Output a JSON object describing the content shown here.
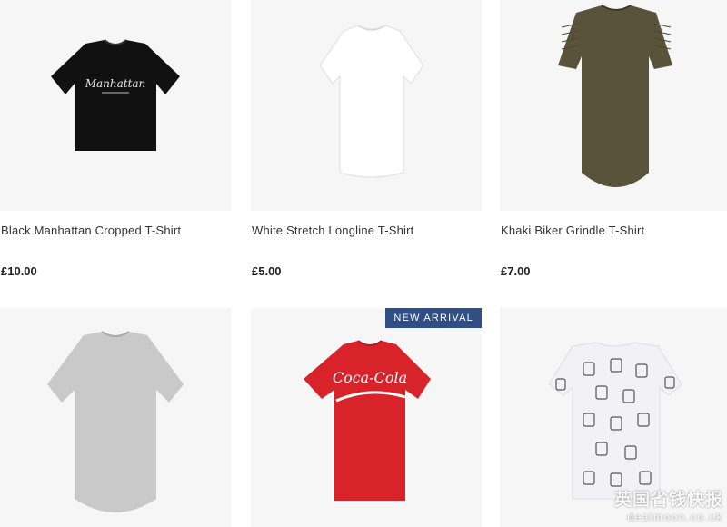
{
  "products": [
    {
      "title": "Black Manhattan Cropped T-Shirt",
      "price": "£10.00",
      "print_text": "Manhattan",
      "shirt_color": "#111111"
    },
    {
      "title": "White Stretch Longline T-Shirt",
      "price": "£5.00",
      "shirt_color": "#ffffff"
    },
    {
      "title": "Khaki Biker Grindle T-Shirt",
      "price": "£7.00",
      "shirt_color": "#5a5436"
    },
    {
      "shirt_color": "#c9c9c9"
    },
    {
      "badge": "NEW ARRIVAL",
      "print_text": "Coca-Cola",
      "shirt_color": "#d8232a"
    },
    {
      "shirt_color": "#f2f2f4"
    }
  ],
  "watermark": {
    "line1": "英国省钱快报",
    "line2": "dealmoon.co.uk"
  },
  "colors": {
    "badge_bg": "#2f4f86",
    "card_bg": "#f6f6f6"
  }
}
